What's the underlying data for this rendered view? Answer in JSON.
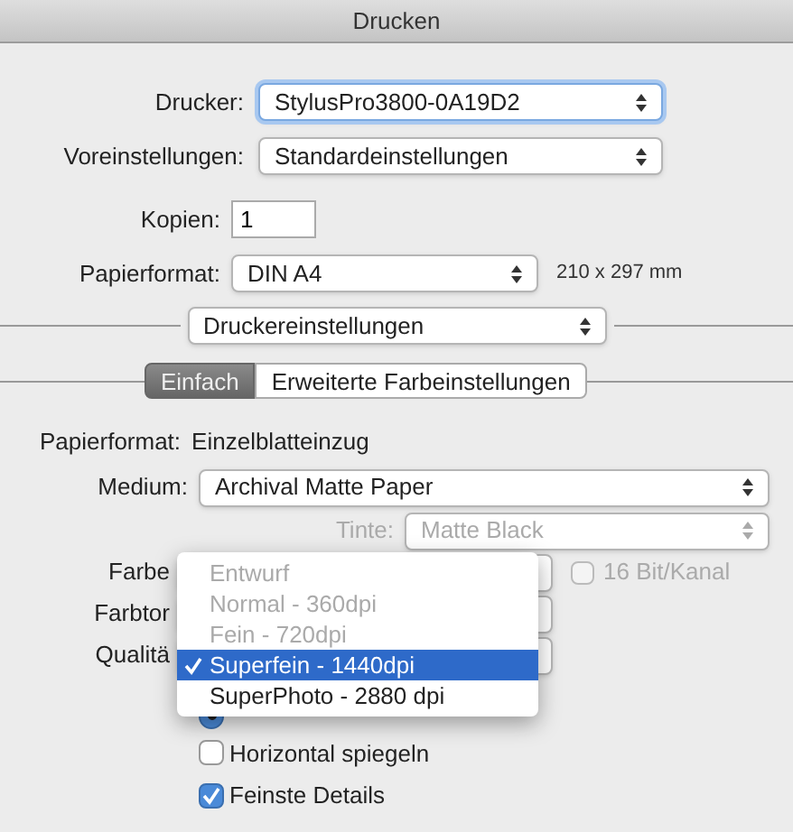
{
  "window": {
    "title": "Drucken"
  },
  "printer": {
    "label": "Drucker:",
    "value": "StylusPro3800-0A19D2"
  },
  "presets": {
    "label": "Voreinstellungen:",
    "value": "Standardeinstellungen"
  },
  "copies": {
    "label": "Kopien:",
    "value": "1"
  },
  "paper": {
    "label": "Papierformat:",
    "value": "DIN A4",
    "size": "210 x 297 mm"
  },
  "panel": {
    "value": "Druckereinstellungen"
  },
  "tabs": [
    {
      "label": "Einfach",
      "selected": true
    },
    {
      "label": "Erweiterte Farbeinstellungen",
      "selected": false
    }
  ],
  "source": {
    "label": "Papierformat:",
    "value": "Einzelblatteinzug"
  },
  "medium": {
    "label": "Medium:",
    "value": "Archival Matte Paper"
  },
  "ink": {
    "label": "Tinte:",
    "value": "Matte Black",
    "disabled": true
  },
  "hidden_rows": [
    {
      "label": "Farbe"
    },
    {
      "label": "Farbtor"
    },
    {
      "label": "Qualitä"
    }
  ],
  "bit_depth": {
    "label": "16 Bit/Kanal",
    "checked": false,
    "disabled": true
  },
  "options": [
    {
      "kind": "radio",
      "checked": true
    },
    {
      "kind": "checkbox",
      "label": "Horizontal spiegeln",
      "checked": false
    },
    {
      "kind": "checkbox",
      "label": "Feinste Details",
      "checked": true
    }
  ],
  "quality_menu": [
    {
      "label": "Entwurf",
      "disabled": true,
      "selected": false
    },
    {
      "label": "Normal - 360dpi",
      "disabled": true,
      "selected": false
    },
    {
      "label": "Fein - 720dpi",
      "disabled": true,
      "selected": false
    },
    {
      "label": "Superfein - 1440dpi",
      "disabled": false,
      "selected": true
    },
    {
      "label": "SuperPhoto - 2880 dpi",
      "disabled": false,
      "selected": false
    }
  ]
}
